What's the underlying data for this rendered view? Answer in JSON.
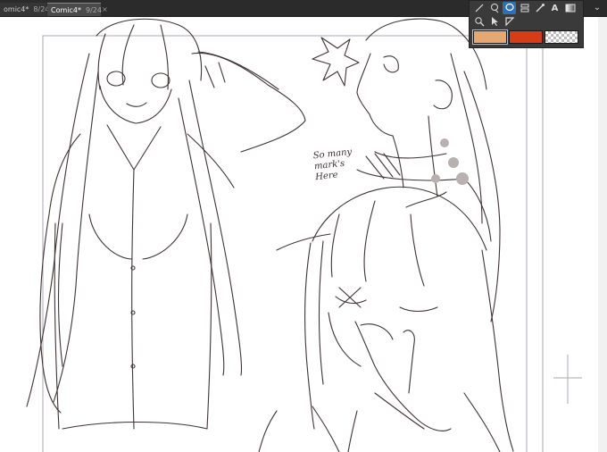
{
  "tabs": [
    {
      "label": "omic4*",
      "page": "8/24",
      "active": false
    },
    {
      "label": "Comic4*",
      "page": "9/24",
      "active": true
    }
  ],
  "tab_close_glyph": "×",
  "collapse_glyph": "⌄",
  "palette": {
    "tools_row1": [
      "line-tool-icon",
      "lasso-select-icon",
      "lasso-fill-icon",
      "layer-stack-icon",
      "eyedropper-icon",
      "text-tool-icon",
      "gradient-icon"
    ],
    "tools_row2": [
      "zoom-icon",
      "object-select-icon",
      "move-icon"
    ],
    "active_tool": "lasso-fill-icon",
    "text_tool_glyph": "A",
    "swatches": [
      {
        "name": "main-color",
        "color": "#e5a873"
      },
      {
        "name": "sub-color",
        "color": "#d63d16"
      },
      {
        "name": "transparent-color",
        "color": "transparent"
      }
    ]
  },
  "canvas": {
    "note_text": "So many\nmark's\nHere",
    "line_color": "#3f3434",
    "frame_color": "#a8a8b4",
    "shade_color": "#b9b0b0"
  }
}
